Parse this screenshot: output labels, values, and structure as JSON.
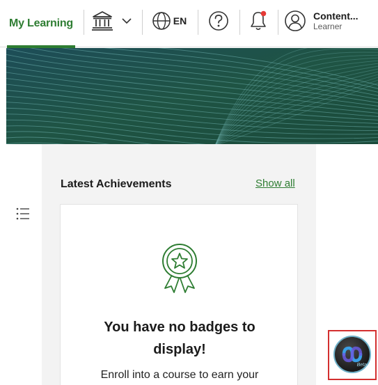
{
  "nav": {
    "my_learning": "My Learning",
    "language": "EN",
    "user_name": "Content...",
    "user_role": "Learner"
  },
  "achievements": {
    "title": "Latest Achievements",
    "show_all": "Show all",
    "empty_title": "You have no badges to display!",
    "empty_description": "Enroll into a course to earn your"
  },
  "assistant": {
    "beta_label": "Beta"
  },
  "colors": {
    "accent_green": "#2e7d32",
    "banner_green": "#1e4d3f",
    "highlight_red": "#d32f2f"
  },
  "icons": [
    "institution-icon",
    "chevron-down-icon",
    "globe-icon",
    "help-icon",
    "bell-icon",
    "user-avatar-icon",
    "list-menu-icon",
    "badge-ribbon-icon",
    "assistant-logo-icon"
  ]
}
